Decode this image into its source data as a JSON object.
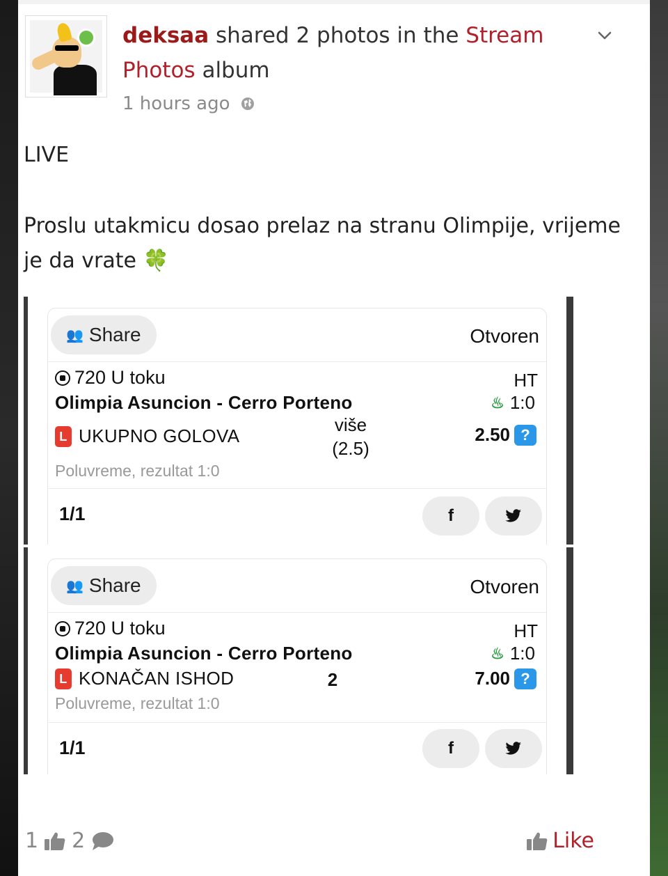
{
  "post": {
    "user": "deksaa",
    "action_text": " shared 2 photos in the ",
    "album_name": "Stream Photos",
    "album_suffix": " album",
    "time": "1 hours ago",
    "text_line1": "LIVE",
    "text_line2": "Proslu utakmicu dosao prelaz na stranu Olimpije, vrijeme je da vrate 🍀"
  },
  "screenshots": [
    {
      "share_label": "Share",
      "status": "Otvoren",
      "match_id": "720 U toku",
      "period": "HT",
      "match_name": "Olimpia Asuncion - Cerro Porteno",
      "score": "1:0",
      "badge": "L",
      "market": "UKUPNO GOLOVA",
      "pick_line1": "više",
      "pick_line2": "(2.5)",
      "odds": "2.50",
      "help": "?",
      "note": "Poluvreme, rezultat 1:0",
      "page": "1/1",
      "fb": "f"
    },
    {
      "share_label": "Share",
      "status": "Otvoren",
      "match_id": "720 U toku",
      "period": "HT",
      "match_name": "Olimpia Asuncion - Cerro Porteno",
      "score": "1:0",
      "badge": "L",
      "market": "KONAČAN ISHOD",
      "pick_line1": "2",
      "odds": "7.00",
      "help": "?",
      "note": "Poluvreme, rezultat 1:0",
      "page": "1/1",
      "fb": "f"
    }
  ],
  "footer": {
    "likes_count": "1",
    "comments_count": "2",
    "like_label": "Like"
  },
  "colors": {
    "accent": "#b0212b",
    "username": "#9b1b1b",
    "badge_red": "#e53c2f",
    "help_blue": "#2b97e8",
    "flame_green": "#2e9c43"
  },
  "icons": [
    "chevron-down-icon",
    "globe-icon",
    "clover-emoji",
    "share-people-icon",
    "soccer-ball-icon",
    "flame-icon",
    "facebook-icon",
    "twitter-icon",
    "thumbs-up-icon",
    "comment-bubble-icon"
  ]
}
